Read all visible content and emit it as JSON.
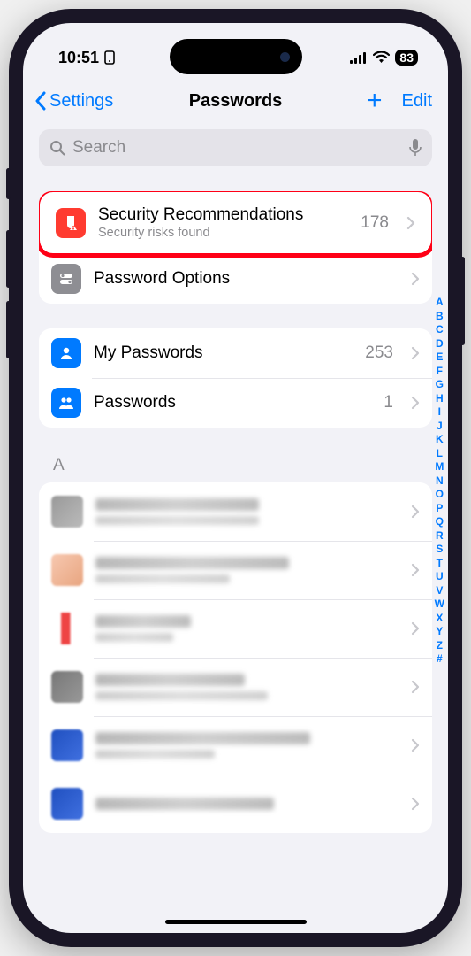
{
  "status": {
    "time": "10:51",
    "battery": "83"
  },
  "nav": {
    "back": "Settings",
    "title": "Passwords",
    "edit": "Edit"
  },
  "search": {
    "placeholder": "Search"
  },
  "rows": {
    "security": {
      "title": "Security Recommendations",
      "sub": "Security risks found",
      "count": "178"
    },
    "options": {
      "title": "Password Options"
    },
    "mine": {
      "title": "My Passwords",
      "count": "253"
    },
    "shared": {
      "title": "Passwords",
      "count": "1"
    }
  },
  "section": {
    "a": "A"
  },
  "index": [
    "A",
    "B",
    "C",
    "D",
    "E",
    "F",
    "G",
    "H",
    "I",
    "J",
    "K",
    "L",
    "M",
    "N",
    "O",
    "P",
    "Q",
    "R",
    "S",
    "T",
    "U",
    "V",
    "W",
    "X",
    "Y",
    "Z",
    "#"
  ]
}
